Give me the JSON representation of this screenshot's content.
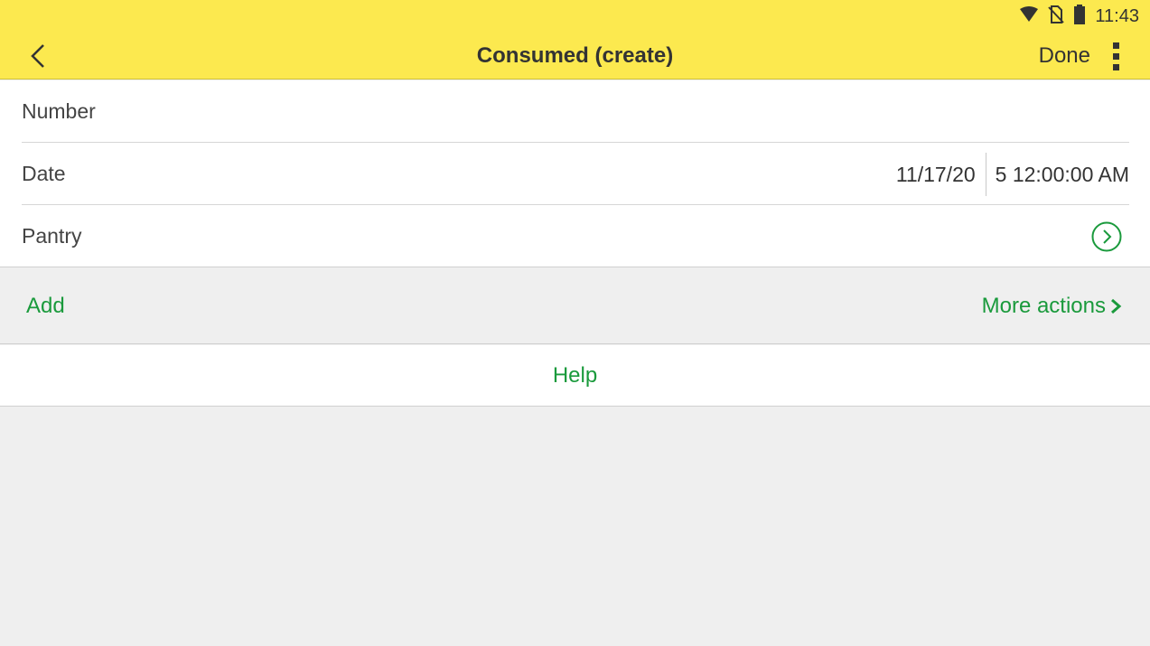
{
  "status_bar": {
    "time": "11:43",
    "icons": [
      "wifi-icon",
      "no-sim-icon",
      "battery-icon"
    ]
  },
  "app_bar": {
    "title": "Consumed (create)",
    "done_label": "Done",
    "back_icon": "chevron-left-icon",
    "menu_icon": "more-vert-icon",
    "background_color": "#fce94f"
  },
  "form": {
    "number_label": "Number",
    "date_label": "Date",
    "date_value": "11/17/20",
    "time_value": "5 12:00:00 AM",
    "pantry_label": "Pantry",
    "pantry_icon": "chevron-right-circle-icon"
  },
  "actions": {
    "add_label": "Add",
    "more_actions_label": "More actions",
    "more_actions_icon": "chevron-right-icon",
    "accent_color": "#1a9a3c"
  },
  "help": {
    "label": "Help"
  }
}
